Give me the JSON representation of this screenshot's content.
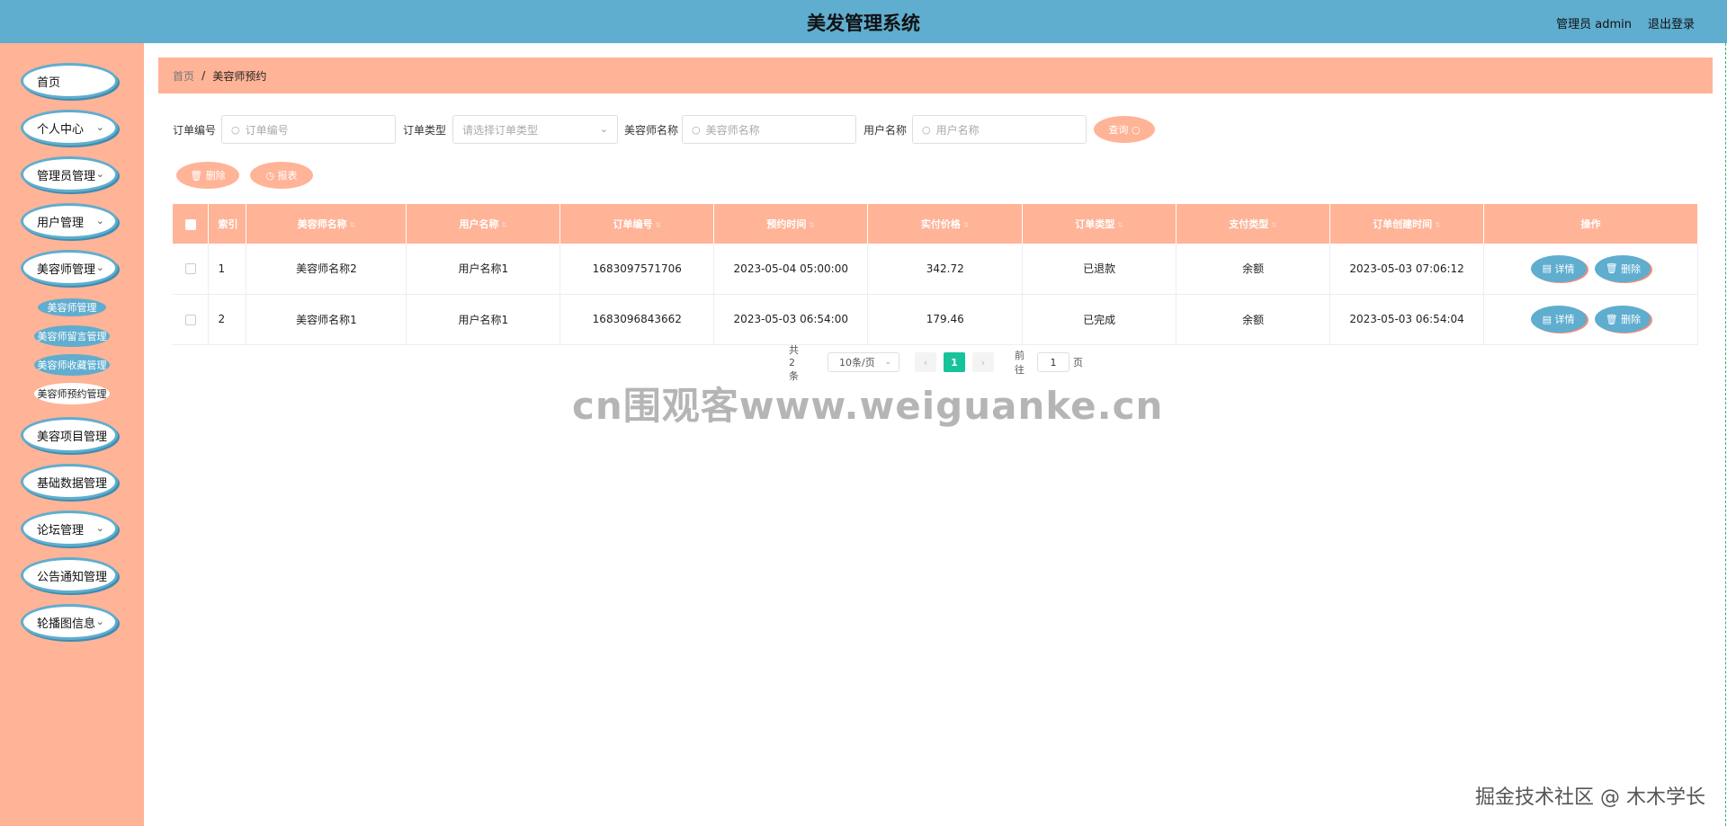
{
  "header": {
    "title": "美发管理系统",
    "user_label": "管理员 admin",
    "logout_label": "退出登录"
  },
  "sidebar": {
    "items": [
      {
        "label": "首页"
      },
      {
        "label": "个人中心"
      },
      {
        "label": "管理员管理"
      },
      {
        "label": "用户管理"
      },
      {
        "label": "美容师管理"
      },
      {
        "label": "美容项目管理"
      },
      {
        "label": "基础数据管理"
      },
      {
        "label": "论坛管理"
      },
      {
        "label": "公告通知管理"
      },
      {
        "label": "轮播图信息"
      }
    ],
    "submenu": [
      {
        "label": "美容师管理"
      },
      {
        "label": "美容师留言管理"
      },
      {
        "label": "美容师收藏管理"
      },
      {
        "label": "美容师预约管理"
      }
    ]
  },
  "breadcrumb": {
    "home": "首页",
    "separator": "/",
    "current": "美容师预约"
  },
  "search": {
    "order_no_label": "订单编号",
    "order_no_placeholder": "订单编号",
    "order_type_label": "订单类型",
    "order_type_placeholder": "请选择订单类型",
    "beautician_label": "美容师名称",
    "beautician_placeholder": "美容师名称",
    "username_label": "用户名称",
    "username_placeholder": "用户名称",
    "query_label": "查询"
  },
  "actions": {
    "delete_label": "删除",
    "report_label": "报表"
  },
  "table": {
    "headers": [
      "索引",
      "美容师名称",
      "用户名称",
      "订单编号",
      "预约时间",
      "实付价格",
      "订单类型",
      "支付类型",
      "订单创建时间",
      "操作"
    ],
    "rows": [
      {
        "index": "1",
        "beautician": "美容师名称2",
        "user": "用户名称1",
        "order_no": "1683097571706",
        "appointment_time": "2023-05-04 05:00:00",
        "price": "342.72",
        "order_type": "已退款",
        "pay_type": "余额",
        "created": "2023-05-03 07:06:12"
      },
      {
        "index": "2",
        "beautician": "美容师名称1",
        "user": "用户名称1",
        "order_no": "1683096843662",
        "appointment_time": "2023-05-03 06:54:00",
        "price": "179.46",
        "order_type": "已完成",
        "pay_type": "余额",
        "created": "2023-05-03 06:54:04"
      }
    ],
    "detail_label": "详情",
    "delete_label": "删除"
  },
  "pagination": {
    "total": "共 2 条",
    "page_size": "10条/页",
    "prev": "‹",
    "current_page": "1",
    "next": "›",
    "goto_label": "前往",
    "goto_value": "1",
    "page_suffix": "页"
  },
  "watermarks": {
    "center": "cn围观客www.weiguanke.cn",
    "corner": "掘金技术社区 @ 木木学长"
  },
  "colors": {
    "header_bg": "#5fadcf",
    "sidebar_bg": "#ffb397",
    "accent": "#ffb397",
    "active_page": "#16c39b"
  }
}
